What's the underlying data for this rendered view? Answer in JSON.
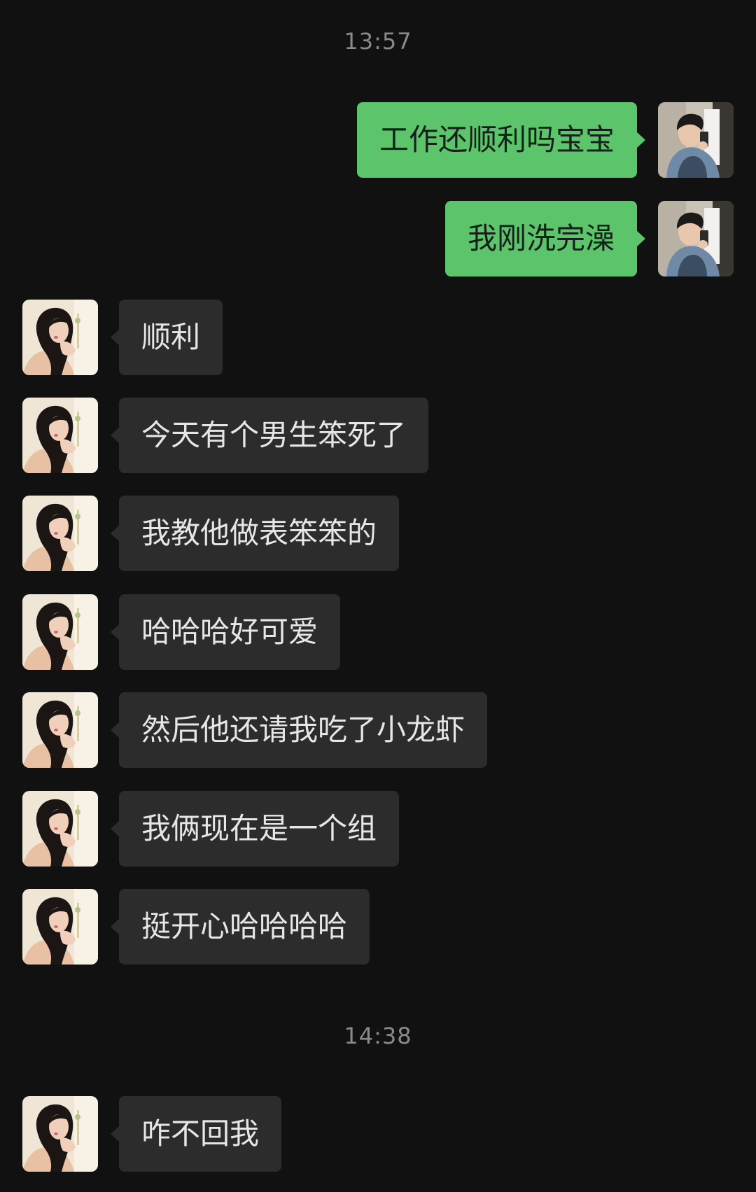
{
  "timestamps": [
    "13:57",
    "14:38"
  ],
  "messages": [
    {
      "from": "me",
      "text": "工作还顺利吗宝宝"
    },
    {
      "from": "me",
      "text": "我刚洗完澡"
    },
    {
      "from": "them",
      "text": "顺利"
    },
    {
      "from": "them",
      "text": "今天有个男生笨死了"
    },
    {
      "from": "them",
      "text": "我教他做表笨笨的"
    },
    {
      "from": "them",
      "text": "哈哈哈好可爱"
    },
    {
      "from": "them",
      "text": "然后他还请我吃了小龙虾"
    },
    {
      "from": "them",
      "text": "我俩现在是一个组"
    },
    {
      "from": "them",
      "text": "挺开心哈哈哈哈"
    },
    {
      "from": "them",
      "text": "咋不回我"
    }
  ],
  "colors": {
    "background": "#111111",
    "incoming_bubble": "#2c2c2c",
    "outgoing_bubble": "#5cc46b",
    "timestamp_text": "#8a8a8a"
  },
  "icons": {
    "my_avatar": "avatar-man-photo-icon",
    "their_avatar": "avatar-woman-photo-icon"
  }
}
